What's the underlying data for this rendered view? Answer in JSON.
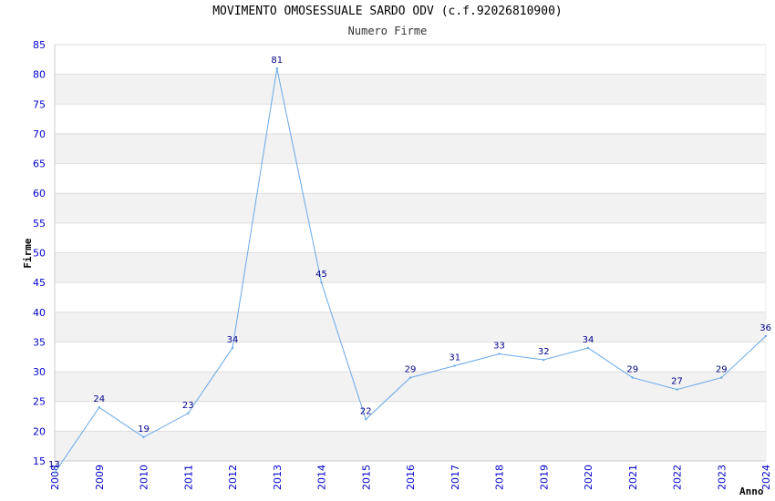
{
  "chart_data": {
    "type": "line",
    "title": "MOVIMENTO OMOSESSUALE SARDO ODV (c.f.92026810900)",
    "subtitle": "Numero Firme",
    "xlabel": "Anno",
    "ylabel": "Firme",
    "ylim": [
      15,
      85
    ],
    "yticks": [
      15,
      20,
      25,
      30,
      35,
      40,
      45,
      50,
      55,
      60,
      65,
      70,
      75,
      80,
      85
    ],
    "x": [
      "2008",
      "2009",
      "2010",
      "2011",
      "2012",
      "2013",
      "2014",
      "2015",
      "2016",
      "2017",
      "2018",
      "2019",
      "2020",
      "2021",
      "2022",
      "2023",
      "2024"
    ],
    "values": [
      13,
      24,
      19,
      23,
      34,
      81,
      45,
      22,
      29,
      31,
      33,
      32,
      34,
      29,
      27,
      29,
      36
    ],
    "grid": true,
    "colors": {
      "line": "#6aa8e8",
      "band": "#f2f2f2",
      "gridline": "#dddddd",
      "tick_text": "#0000cc",
      "data_label": "#00008b"
    }
  }
}
